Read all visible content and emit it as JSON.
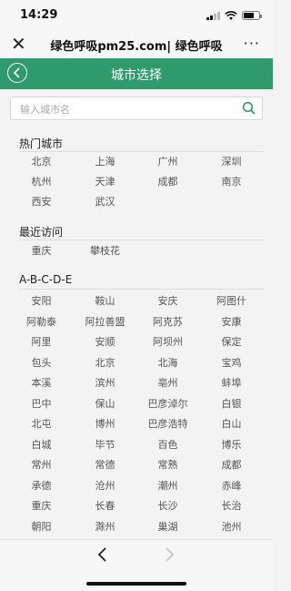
{
  "status_bar": {
    "time": "14:29"
  },
  "nav": {
    "title": "绿色呼吸pm25.com| 绿色呼吸",
    "more_label": "···"
  },
  "header": {
    "title": "城市选择"
  },
  "search": {
    "placeholder": "输入城市名"
  },
  "sections": [
    {
      "title": "热门城市",
      "cities": [
        "北京",
        "上海",
        "广州",
        "深圳",
        "杭州",
        "天津",
        "成都",
        "南京",
        "西安",
        "武汉"
      ]
    },
    {
      "title": "最近访问",
      "cities": [
        "重庆",
        "攀枝花"
      ]
    },
    {
      "title": "A-B-C-D-E",
      "cities": [
        "安阳",
        "鞍山",
        "安庆",
        "阿图什",
        "阿勒泰",
        "阿拉善盟",
        "阿克苏",
        "安康",
        "阿里",
        "安顺",
        "阿坝州",
        "保定",
        "包头",
        "北京",
        "北海",
        "宝鸡",
        "本溪",
        "滨州",
        "亳州",
        "蚌埠",
        "巴中",
        "保山",
        "巴彦淖尔",
        "白银",
        "北屯",
        "博州",
        "巴彦浩特",
        "白山",
        "白城",
        "毕节",
        "百色",
        "博乐",
        "常州",
        "常德",
        "常熟",
        "成都",
        "承德",
        "沧州",
        "潮州",
        "赤峰",
        "重庆",
        "长春",
        "长沙",
        "长治",
        "朝阳",
        "滁州",
        "巢湖",
        "池州"
      ]
    }
  ]
}
